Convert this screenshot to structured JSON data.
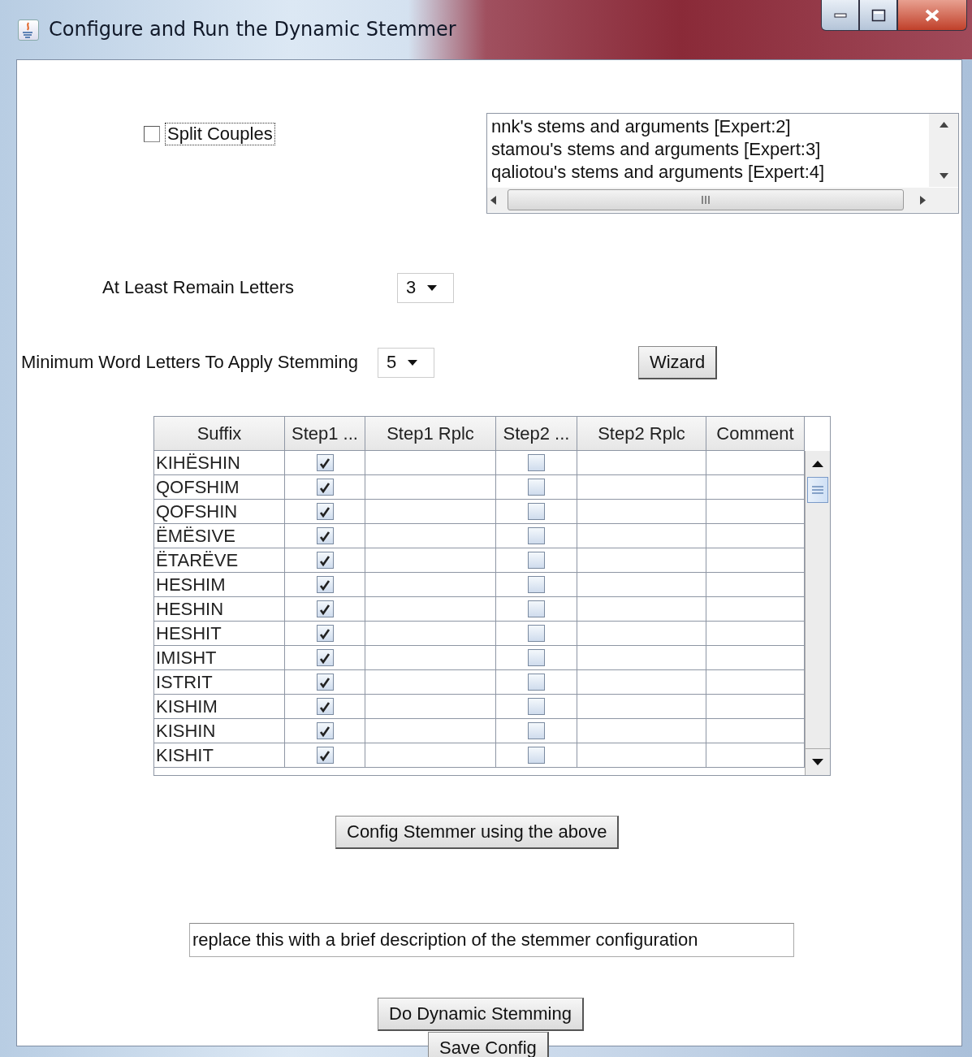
{
  "window": {
    "title": "Configure and Run the Dynamic Stemmer"
  },
  "split_couples": {
    "label": "Split Couples",
    "checked": false,
    "focused": true
  },
  "experts_list": {
    "items": [
      {
        "label": "nnk's stems and arguments [Expert:2]"
      },
      {
        "label": "stamou's stems and arguments [Expert:3]"
      },
      {
        "label": "qaliotou's stems and arguments [Expert:4]"
      }
    ]
  },
  "at_least_remain_letters": {
    "label": "At Least Remain Letters",
    "value": "3"
  },
  "minimum_word_letters": {
    "label": "Minimum Word Letters To Apply Stemming",
    "value": "5"
  },
  "wizard_button": "Wizard",
  "suffix_table": {
    "columns": [
      "Suffix",
      "Step1 ...",
      "Step1 Rplc",
      "Step2 ...",
      "Step2 Rplc",
      "Comment"
    ],
    "rows": [
      {
        "suffix": "KIHËSHIN",
        "step1": true,
        "step2": false
      },
      {
        "suffix": "QOFSHIM",
        "step1": true,
        "step2": false
      },
      {
        "suffix": "QOFSHIN",
        "step1": true,
        "step2": false
      },
      {
        "suffix": "ËMËSIVE",
        "step1": true,
        "step2": false
      },
      {
        "suffix": "ËTARËVE",
        "step1": true,
        "step2": false
      },
      {
        "suffix": "HESHIM",
        "step1": true,
        "step2": false
      },
      {
        "suffix": "HESHIN",
        "step1": true,
        "step2": false
      },
      {
        "suffix": "HESHIT",
        "step1": true,
        "step2": false
      },
      {
        "suffix": "IMISHT",
        "step1": true,
        "step2": false
      },
      {
        "suffix": "ISTRIT",
        "step1": true,
        "step2": false
      },
      {
        "suffix": "KISHIM",
        "step1": true,
        "step2": false
      },
      {
        "suffix": "KISHIN",
        "step1": true,
        "step2": false
      },
      {
        "suffix": "KISHIT",
        "step1": true,
        "step2": false
      }
    ]
  },
  "config_button": "Config Stemmer using the above",
  "description_field": {
    "value": "replace this with a brief description of the stemmer configuration"
  },
  "buttons": [
    "Do Dynamic Stemming",
    "Save Config"
  ]
}
